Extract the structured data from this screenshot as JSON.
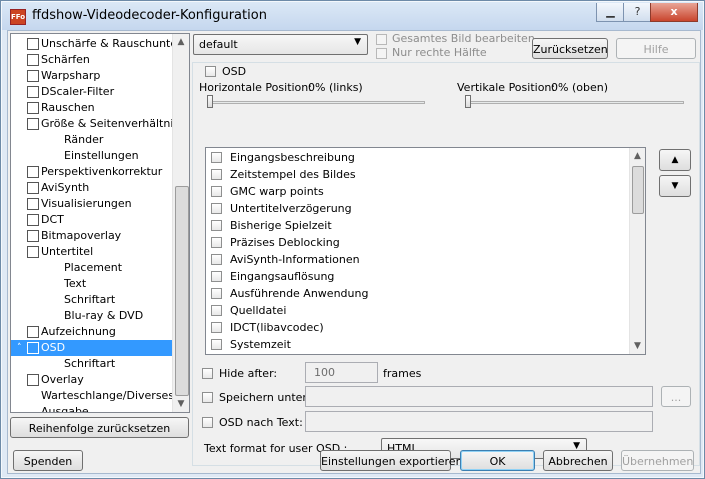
{
  "window": {
    "title": "ffdshow-Videodecoder-Konfiguration",
    "app_icon_text": "FFo",
    "help_glyph": "?",
    "close_glyph": "x"
  },
  "tree": {
    "items": [
      {
        "label": "Unschärfe & Rauschunterdrü",
        "checkbox": true,
        "indent": 0
      },
      {
        "label": "Schärfen",
        "checkbox": true,
        "indent": 0
      },
      {
        "label": "Warpsharp",
        "checkbox": true,
        "indent": 0
      },
      {
        "label": "DScaler-Filter",
        "checkbox": true,
        "indent": 0
      },
      {
        "label": "Rauschen",
        "checkbox": true,
        "indent": 0
      },
      {
        "label": "Größe & Seitenverhältnis",
        "checkbox": true,
        "indent": 0
      },
      {
        "label": "Ränder",
        "checkbox": false,
        "indent": 1
      },
      {
        "label": "Einstellungen",
        "checkbox": false,
        "indent": 1
      },
      {
        "label": "Perspektivenkorrektur",
        "checkbox": true,
        "indent": 0
      },
      {
        "label": "AviSynth",
        "checkbox": true,
        "indent": 0
      },
      {
        "label": "Visualisierungen",
        "checkbox": true,
        "indent": 0
      },
      {
        "label": "DCT",
        "checkbox": true,
        "indent": 0
      },
      {
        "label": "Bitmapoverlay",
        "checkbox": true,
        "indent": 0
      },
      {
        "label": "Untertitel",
        "checkbox": true,
        "indent": 0
      },
      {
        "label": "Placement",
        "checkbox": false,
        "indent": 1
      },
      {
        "label": "Text",
        "checkbox": false,
        "indent": 1
      },
      {
        "label": "Schriftart",
        "checkbox": false,
        "indent": 1
      },
      {
        "label": "Blu-ray & DVD",
        "checkbox": false,
        "indent": 1
      },
      {
        "label": "Aufzeichnung",
        "checkbox": true,
        "indent": 0
      },
      {
        "label": "OSD",
        "checkbox": true,
        "indent": 0,
        "selected": true
      },
      {
        "label": "Schriftart",
        "checkbox": false,
        "indent": 1
      },
      {
        "label": "Overlay",
        "checkbox": true,
        "indent": 0
      },
      {
        "label": "Warteschlange/Diverses",
        "checkbox": false,
        "indent": 0
      },
      {
        "label": "Ausgabe",
        "checkbox": false,
        "indent": 0
      }
    ],
    "reset_order_button": "Reihenfolge zurücksetzen"
  },
  "top": {
    "preset_value": "default",
    "whole_image_label": "Gesamtes Bild bearbeiten",
    "right_half_label": "Nur rechte Hälfte",
    "reset_button": "Zurücksetzen",
    "help_button": "Hilfe"
  },
  "osd": {
    "enable_label": "OSD",
    "horizontal_label": "Horizontale Position:",
    "horizontal_value": "0% (links)",
    "horizontal_level": 0,
    "vertical_label": "Vertikale Position:",
    "vertical_value": "0% (oben)",
    "vertical_level": 0,
    "items": [
      "Eingangsbeschreibung",
      "Zeitstempel des Bildes",
      "GMC warp points",
      "Untertitelverzögerung",
      "Bisherige Spielzeit",
      "Präzises Deblocking",
      "AviSynth-Informationen",
      "Eingangsauflösung",
      "Ausführende Anwendung",
      "Quelldatei",
      "IDCT(libavcodec)",
      "Systemzeit"
    ],
    "up_glyph": "▲",
    "down_glyph": "▼",
    "hide_after_label": "Hide after:",
    "hide_after_value": "100",
    "frames_label": "frames",
    "save_under_label": "Speichern unter:",
    "save_under_value": "",
    "browse_button": "...",
    "osd_to_text_label": "OSD nach Text:",
    "osd_to_text_value": "",
    "text_format_label": "Text format for user OSD :",
    "text_format_value": "HTML"
  },
  "bottom": {
    "donate_button": "Spenden",
    "export_button": "Einstellungen exportieren",
    "ok_button": "OK",
    "cancel_button": "Abbrechen",
    "apply_button": "Übernehmen"
  }
}
